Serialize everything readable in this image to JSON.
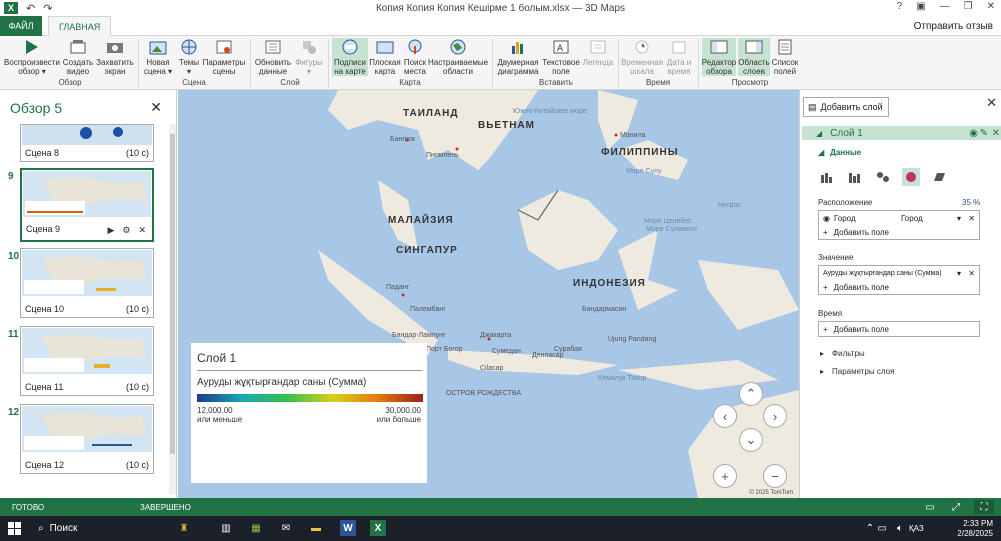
{
  "app": {
    "title": "Копия Копия Копия Кешірме 1 болым.xlsx — 3D Maps",
    "quick_access": [
      "↶",
      "↷"
    ],
    "help": "?"
  },
  "tabs": {
    "file": "ФАЙЛ",
    "home": "ГЛАВНАЯ",
    "feedback": "Отправить отзыв"
  },
  "ribbon": {
    "buttons": [
      {
        "id": "play-tour",
        "label": "Воспроизвести обзор ▾",
        "icon": "play-icon"
      },
      {
        "id": "create-video",
        "label": "Создать видео",
        "icon": "video-icon"
      },
      {
        "id": "capture-screen",
        "label": "Захватить экран",
        "icon": "camera-icon"
      },
      {
        "id": "new-scene",
        "label": "Новая сцена ▾",
        "icon": "scene-icon"
      },
      {
        "id": "themes",
        "label": "Темы ▾",
        "icon": "globe-icon"
      },
      {
        "id": "scene-options",
        "label": "Параметры сцены",
        "icon": "settings-icon"
      },
      {
        "id": "refresh-data",
        "label": "Обновить данные",
        "icon": "refresh-icon"
      },
      {
        "id": "shapes",
        "label": "Фигуры ▾",
        "icon": "shapes-icon"
      },
      {
        "id": "map-labels",
        "label": "Подписи на карте",
        "icon": "labels-icon"
      },
      {
        "id": "flat-map",
        "label": "Плоская карта",
        "icon": "flatmap-icon"
      },
      {
        "id": "find-location",
        "label": "Поиск места",
        "icon": "find-icon"
      },
      {
        "id": "custom-regions",
        "label": "Настраиваемые области",
        "icon": "regions-icon"
      },
      {
        "id": "2d-chart",
        "label": "Двумерная диаграмма",
        "icon": "chart-icon"
      },
      {
        "id": "text-box",
        "label": "Текстовое поле",
        "icon": "textbox-icon"
      },
      {
        "id": "legend",
        "label": "Легенда",
        "icon": "legend-icon"
      },
      {
        "id": "timeline",
        "label": "Временная шкала",
        "icon": "timeline-icon"
      },
      {
        "id": "date-time",
        "label": "Дата и время",
        "icon": "datetime-icon"
      },
      {
        "id": "tour-editor",
        "label": "Редактор обзора",
        "icon": "tour-editor-icon"
      },
      {
        "id": "layer-pane",
        "label": "Область слоев",
        "icon": "layer-pane-icon"
      },
      {
        "id": "field-list",
        "label": "Список полей",
        "icon": "field-list-icon"
      }
    ],
    "groups": [
      "Обзор",
      "Сцена",
      "Слой",
      "Карта",
      "Вставить",
      "Время",
      "Просмотр"
    ]
  },
  "tour": {
    "title": "Обзор 5",
    "scenes": [
      {
        "num": "",
        "name": "Сцена 8",
        "duration": "(10 с)"
      },
      {
        "num": "9",
        "name": "Сцена 9",
        "duration": "(10 с)"
      },
      {
        "num": "10",
        "name": "Сцена 10",
        "duration": "(10 с)"
      },
      {
        "num": "11",
        "name": "Сцена 11",
        "duration": "(10 с)"
      },
      {
        "num": "12",
        "name": "Сцена 12",
        "duration": "(10 с)"
      }
    ]
  },
  "map": {
    "countries": [
      "ТАИЛАНД",
      "ВЬЕТНАМ",
      "ФИЛИППИНЫ",
      "МАЛАЙЗИЯ",
      "СИНГАПУР",
      "ИНДОНЕЗИЯ"
    ],
    "cities": [
      "Бангкок",
      "Пномпень",
      "Манила",
      "Паданг",
      "Палембанг",
      "Бандар-Лампунг",
      "Джакарта",
      "Порт Богор",
      "Сумедан",
      "Сурабая",
      "Бандармасин",
      "Ujung Pandang",
      "Денпасар",
      "Cilacap"
    ],
    "seas": [
      "Южно-Китайское море",
      "Море Сулу",
      "Море Целебес",
      "Море Сулавеси",
      "Негрос",
      "Кемалук Тивор",
      "ОСТРОВ РОЖДЕСТВА"
    ],
    "copyright": "© 2025 TomTom",
    "legend": {
      "title": "Слой 1",
      "measure": "Ауруды жұқтырғандар саны (Сумма)",
      "min": "12,000.00",
      "max": "30,000.00",
      "min_note": "или меньше",
      "max_note": "или больше"
    }
  },
  "layers": {
    "add_button": "Добавить слой",
    "layer_name": "Слой 1",
    "data_header": "Данные",
    "location_label": "Расположение",
    "location_percent": "35 %",
    "location_field": "Город",
    "location_type": "Город",
    "add_field": "Добавить поле",
    "value_label": "Значение",
    "value_field": "Ауруды жұқтырғандар саны (Сумма)",
    "time_label": "Время",
    "filters": "Фильтры",
    "layer_options": "Параметры слоя"
  },
  "status": {
    "ready": "ГОТОВО",
    "done": "ЗАВЕРШЕНО"
  },
  "taskbar": {
    "search": "Поиск",
    "lang": "ҚАЗ",
    "time": "2:33 PM",
    "date": "2/28/2025"
  }
}
